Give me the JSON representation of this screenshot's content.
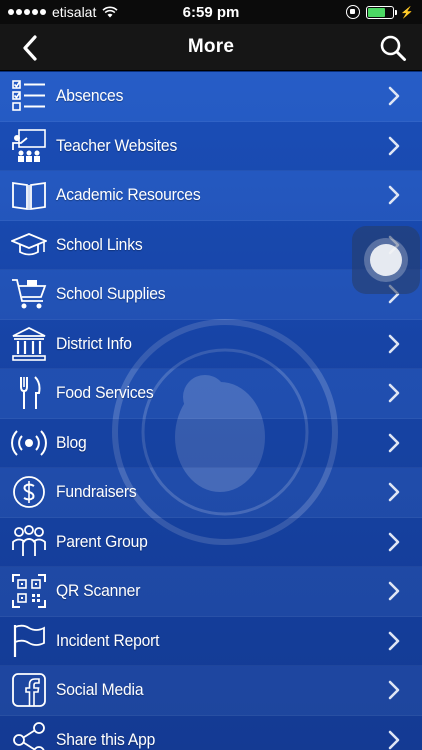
{
  "status_bar": {
    "carrier": "etisalat",
    "time": "6:59 pm",
    "signal_icon": "signal-dots-icon",
    "wifi_icon": "wifi-icon",
    "battery_icon": "battery-icon",
    "battery_level": 0.7,
    "battery_color": "#4cd964"
  },
  "nav": {
    "title": "More",
    "back_icon": "chevron-left-icon",
    "search_icon": "search-icon"
  },
  "menu": {
    "items": [
      {
        "label": "Absences",
        "icon": "checklist-icon"
      },
      {
        "label": "Teacher Websites",
        "icon": "teacher-icon"
      },
      {
        "label": "Academic Resources",
        "icon": "book-icon"
      },
      {
        "label": "School Links",
        "icon": "graduation-cap-icon"
      },
      {
        "label": "School Supplies",
        "icon": "shopping-cart-icon"
      },
      {
        "label": "District Info",
        "icon": "building-icon"
      },
      {
        "label": "Food Services",
        "icon": "fork-knife-icon"
      },
      {
        "label": "Blog",
        "icon": "broadcast-icon"
      },
      {
        "label": "Fundraisers",
        "icon": "dollar-coin-icon"
      },
      {
        "label": "Parent Group",
        "icon": "people-group-icon"
      },
      {
        "label": "QR Scanner",
        "icon": "qr-code-icon"
      },
      {
        "label": "Incident Report",
        "icon": "flag-icon"
      },
      {
        "label": "Social Media",
        "icon": "facebook-icon"
      },
      {
        "label": "Share this App",
        "icon": "share-icon"
      }
    ]
  },
  "colors": {
    "list_top": "#1f58c6",
    "list_bottom": "#163f99",
    "nav_background": "#161616"
  }
}
